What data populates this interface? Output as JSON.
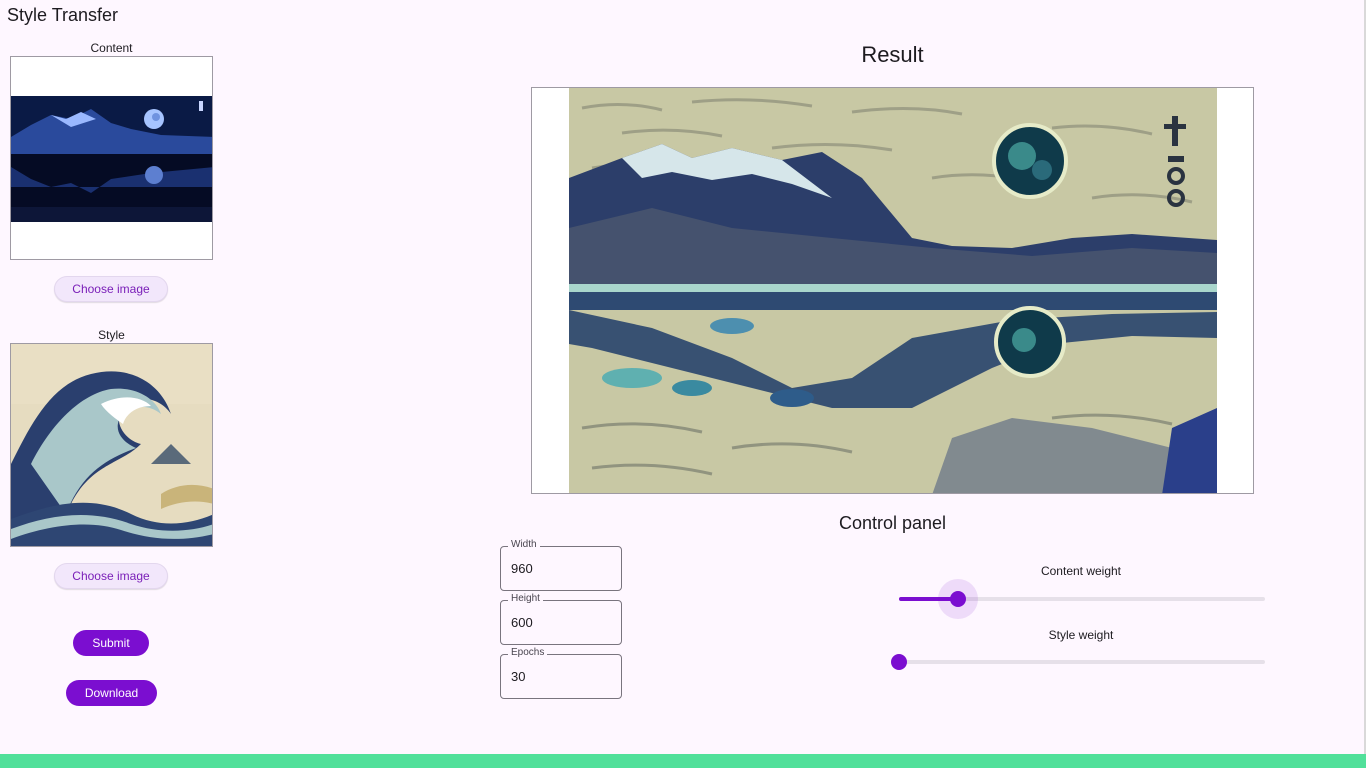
{
  "app": {
    "title": "Style Transfer"
  },
  "content_panel": {
    "label": "Content",
    "button_label": "Choose image"
  },
  "style_panel": {
    "label": "Style",
    "button_label": "Choose image"
  },
  "actions": {
    "submit_label": "Submit",
    "download_label": "Download"
  },
  "result": {
    "heading": "Result"
  },
  "control_panel": {
    "heading": "Control panel",
    "fields": [
      {
        "label": "Width",
        "value": "960"
      },
      {
        "label": "Height",
        "value": "600"
      },
      {
        "label": "Epochs",
        "value": "30"
      }
    ],
    "sliders": [
      {
        "label": "Content weight",
        "value_fraction": 0.16
      },
      {
        "label": "Style weight",
        "value_fraction": 0.0
      }
    ]
  },
  "colors": {
    "background": "#fef7ff",
    "accent": "#7b0ed0",
    "chip_background": "#f2e7fb",
    "bottom_bar": "#51e09a"
  },
  "icons": {
    "content_image": "night-lake-mountains-moon-image",
    "style_image": "great-wave-painting-image",
    "result_image": "stylized-lake-mountains-image"
  }
}
